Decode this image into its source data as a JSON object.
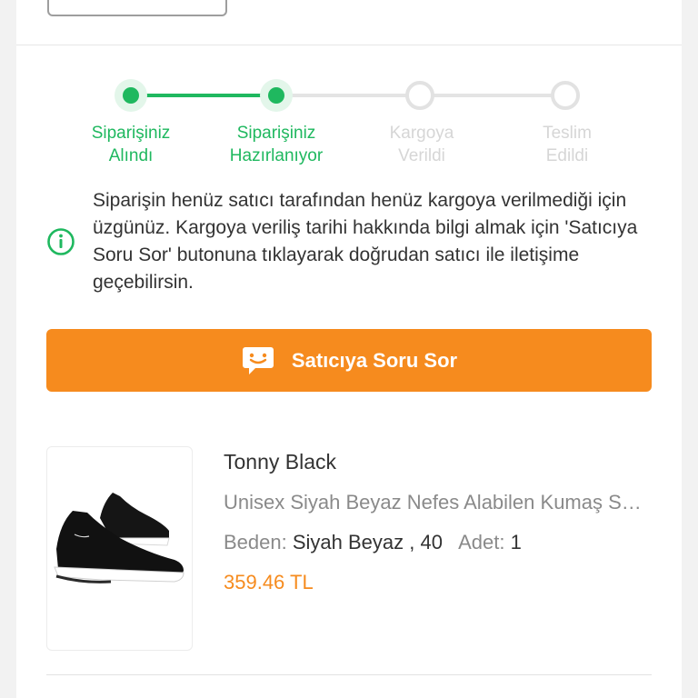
{
  "stepper": {
    "steps": [
      {
        "label": "Siparişiniz\nAlındı",
        "status": "done"
      },
      {
        "label": "Siparişiniz\nHazırlanıyor",
        "status": "done"
      },
      {
        "label": "Kargoya\nVerildi",
        "status": "pending"
      },
      {
        "label": "Teslim\nEdildi",
        "status": "pending"
      }
    ],
    "active_color": "#1fb85f",
    "inactive_color": "#e2e2e2"
  },
  "info": {
    "icon": "info-circle-icon",
    "text": "Siparişin henüz satıcı tarafından henüz kargoya verilmediği için üzgünüz. Kargoya veriliş tarihi hakkında bilgi almak için 'Satıcıya Soru Sor' butonuna tıklayarak doğrudan satıcı ile iletişime geçebilirsin."
  },
  "ask_button": {
    "label": "Satıcıya Soru Sor",
    "icon": "chat-bubble-icon",
    "color": "#f68b1e"
  },
  "product": {
    "brand": "Tonny Black",
    "name": "Unisex Siyah Beyaz Nefes Alabilen Kumaş Spor Ayakkabı",
    "size_label": "Beden:",
    "size_value": "Siyah Beyaz , 40",
    "qty_label": "Adet:",
    "qty_value": "1",
    "price": "359.46 TL",
    "image_icon": "black-sneaker-image"
  }
}
